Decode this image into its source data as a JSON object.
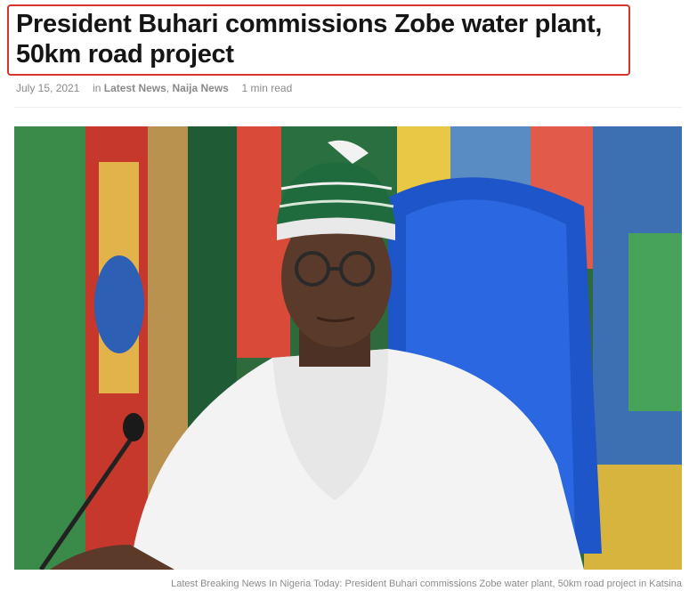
{
  "article": {
    "title": "President Buhari commissions Zobe water plant, 50km road project",
    "date": "July 15, 2021",
    "in_label": "in",
    "categories": [
      "Latest News",
      "Naija News"
    ],
    "read_time": "1 min read"
  },
  "image": {
    "caption": "Latest Breaking News In Nigeria Today: President Buhari commissions Zobe water plant, 50km road project in Katsina"
  },
  "colors": {
    "highlight_border": "#d9332d",
    "headline": "#151515",
    "meta_text": "#8a8a8a"
  }
}
